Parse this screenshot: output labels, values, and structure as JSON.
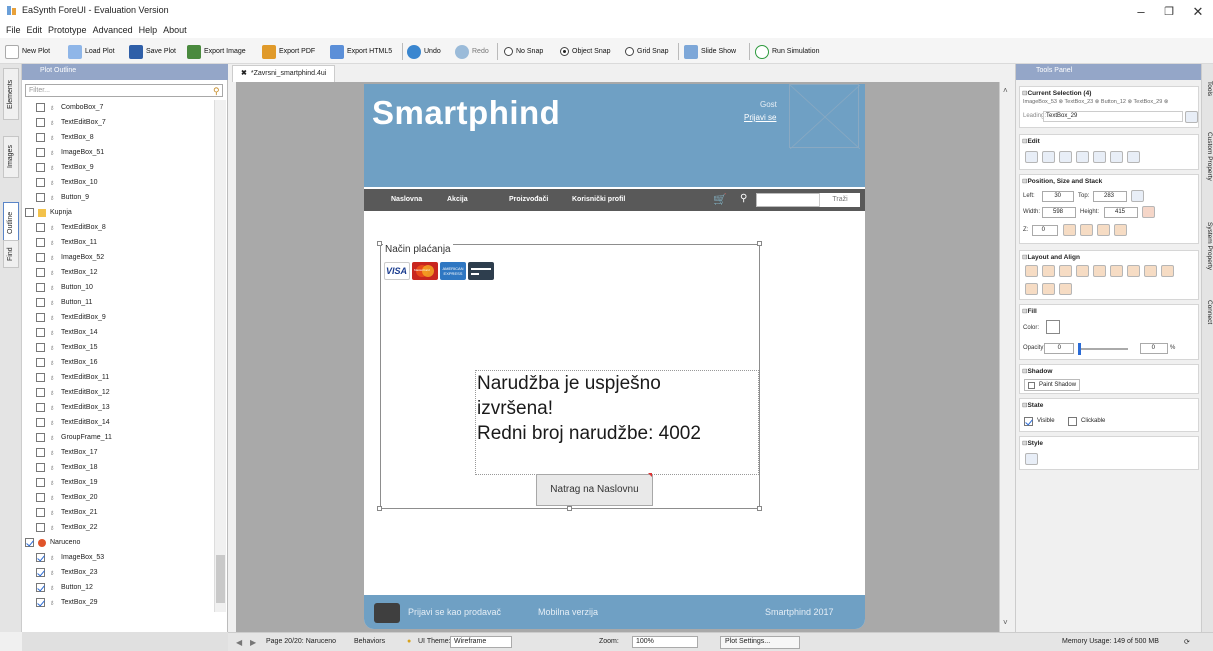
{
  "window": {
    "title": "EaSynth ForeUI - Evaluation Version"
  },
  "menu": [
    "File",
    "Edit",
    "Prototype",
    "Advanced",
    "Help",
    "About"
  ],
  "toolbar": {
    "new_plot": "New Plot",
    "load_plot": "Load Plot",
    "save_plot": "Save Plot",
    "export_image": "Export Image",
    "export_pdf": "Export PDF",
    "export_html5": "Export HTML5",
    "undo": "Undo",
    "redo": "Redo",
    "no_snap": "No Snap",
    "object_snap": "Object Snap",
    "grid_snap": "Grid Snap",
    "slide_show": "Slide Show",
    "run_simulation": "Run Simulation"
  },
  "left_tabs": [
    "Elements",
    "Images",
    "Outline",
    "Find"
  ],
  "outline": {
    "title": "Plot Outline",
    "filter_placeholder": "Filter...",
    "items": [
      {
        "label": "ComboBox_7",
        "checked": false,
        "kind": "el",
        "level": 2
      },
      {
        "label": "TextEditBox_7",
        "checked": false,
        "kind": "el",
        "level": 2
      },
      {
        "label": "TextBox_8",
        "checked": false,
        "kind": "el",
        "level": 2
      },
      {
        "label": "ImageBox_51",
        "checked": false,
        "kind": "el",
        "level": 2
      },
      {
        "label": "TextBox_9",
        "checked": false,
        "kind": "el",
        "level": 2
      },
      {
        "label": "TextBox_10",
        "checked": false,
        "kind": "el",
        "level": 2
      },
      {
        "label": "Button_9",
        "checked": false,
        "kind": "el",
        "level": 2
      },
      {
        "label": "Kupnja",
        "checked": false,
        "kind": "page",
        "level": 1
      },
      {
        "label": "TextEditBox_8",
        "checked": false,
        "kind": "el",
        "level": 2
      },
      {
        "label": "TextBox_11",
        "checked": false,
        "kind": "el",
        "level": 2
      },
      {
        "label": "ImageBox_52",
        "checked": false,
        "kind": "el",
        "level": 2
      },
      {
        "label": "TextBox_12",
        "checked": false,
        "kind": "el",
        "level": 2
      },
      {
        "label": "Button_10",
        "checked": false,
        "kind": "el",
        "level": 2
      },
      {
        "label": "Button_11",
        "checked": false,
        "kind": "el",
        "level": 2
      },
      {
        "label": "TextEditBox_9",
        "checked": false,
        "kind": "el",
        "level": 2
      },
      {
        "label": "TextBox_14",
        "checked": false,
        "kind": "el",
        "level": 2
      },
      {
        "label": "TextBox_15",
        "checked": false,
        "kind": "el",
        "level": 2
      },
      {
        "label": "TextBox_16",
        "checked": false,
        "kind": "el",
        "level": 2
      },
      {
        "label": "TextEditBox_11",
        "checked": false,
        "kind": "el",
        "level": 2
      },
      {
        "label": "TextEditBox_12",
        "checked": false,
        "kind": "el",
        "level": 2
      },
      {
        "label": "TextEditBox_13",
        "checked": false,
        "kind": "el",
        "level": 2
      },
      {
        "label": "TextEditBox_14",
        "checked": false,
        "kind": "el",
        "level": 2
      },
      {
        "label": "GroupFrame_11",
        "checked": false,
        "kind": "el",
        "level": 2
      },
      {
        "label": "TextBox_17",
        "checked": false,
        "kind": "el",
        "level": 2
      },
      {
        "label": "TextBox_18",
        "checked": false,
        "kind": "el",
        "level": 2
      },
      {
        "label": "TextBox_19",
        "checked": false,
        "kind": "el",
        "level": 2
      },
      {
        "label": "TextBox_20",
        "checked": false,
        "kind": "el",
        "level": 2
      },
      {
        "label": "TextBox_21",
        "checked": false,
        "kind": "el",
        "level": 2
      },
      {
        "label": "TextBox_22",
        "checked": false,
        "kind": "el",
        "level": 2
      },
      {
        "label": "Naruceno",
        "checked": true,
        "kind": "page-active",
        "level": 1
      },
      {
        "label": "ImageBox_53",
        "checked": true,
        "kind": "el",
        "level": 2
      },
      {
        "label": "TextBox_23",
        "checked": true,
        "kind": "el",
        "level": 2
      },
      {
        "label": "Button_12",
        "checked": true,
        "kind": "el",
        "level": 2
      },
      {
        "label": "TextBox_29",
        "checked": true,
        "kind": "el",
        "level": 2
      }
    ]
  },
  "document_tab": "*Zavrsni_smartphind.4ui",
  "phone": {
    "brand": "Smartphind",
    "guest": "Gost",
    "login_link": "Prijavi se",
    "nav": [
      "Naslovna",
      "Akcija",
      "Proizvođači",
      "Korisnički profil"
    ],
    "search_button": "Traži",
    "frame_label": "Način plaćanja",
    "card_labels": [
      "VISA",
      "MasterCard",
      "AMERICAN EXPRESS"
    ],
    "message_lines": [
      "Narudžba je uspješno",
      "izvršena!",
      "Redni broj narudžbe: 4002"
    ],
    "back_button": "Natrag na Naslovnu",
    "footer_seller": "Prijavi se kao prodavač",
    "footer_mobile": "Mobilna verzija",
    "footer_copy": "Smartphind 2017"
  },
  "status": {
    "page": "Page 20/20: Naruceno",
    "behaviors": "Behaviors",
    "ui_theme_label": "UI Theme:",
    "ui_theme_value": "Wireframe",
    "zoom_label": "Zoom:",
    "zoom_value": "100%",
    "plot_settings": "Plot Settings...",
    "memory": "Memory Usage: 149 of 500 MB"
  },
  "tool_panel": {
    "title": "Tools Panel",
    "current_selection_title": "Current Selection (4)",
    "selection_items": "ImageBox_53 ⊗ TextBox_23 ⊗ Button_12 ⊗ TextBox_29 ⊗",
    "leading_label": "Leading:",
    "leading_value": "TextBox_29",
    "edit_title": "Edit",
    "pos_title": "Position, Size and Stack",
    "left_label": "Left:",
    "left_value": "30",
    "top_label": "Top:",
    "top_value": "283",
    "width_label": "Width:",
    "width_value": "598",
    "height_label": "Height:",
    "height_value": "415",
    "z_label": "Z:",
    "z_value": "0",
    "layout_title": "Layout and Align",
    "fill_title": "Fill",
    "color_label": "Color:",
    "opacity_label": "Opacity:",
    "opacity_value": "0",
    "opacity_value2": "0",
    "percent": "%",
    "shadow_title": "Shadow",
    "paint_shadow": "Paint Shadow",
    "state_title": "State",
    "visible": "Visible",
    "clickable": "Clickable",
    "style_title": "Style"
  },
  "right_tabs": [
    "Tools",
    "Custom Property",
    "System Property",
    "Connect"
  ]
}
